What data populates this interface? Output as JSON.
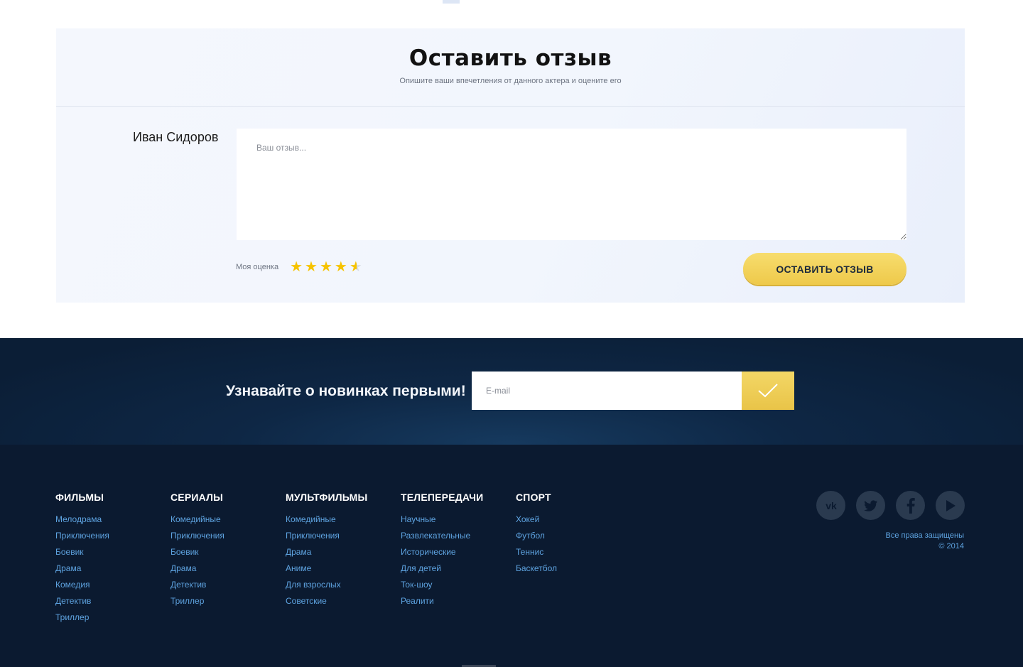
{
  "review": {
    "title": "Оставить отзыв",
    "subtitle": "Опишите ваши впечетления от данного актера и оцените его",
    "author": "Иван Сидоров",
    "textarea_placeholder": "Ваш отзыв...",
    "rating_label": "Моя оценка",
    "rating_value": 4.5,
    "rating_max": 5,
    "submit_label": "ОСТАВИТЬ ОТЗЫВ"
  },
  "subscribe": {
    "title": "Узнавайте о новинках первыми!",
    "email_placeholder": "E-mail",
    "submit_icon": "checkmark-icon"
  },
  "footer": {
    "columns": [
      {
        "title": "ФИЛЬМЫ",
        "links": [
          "Мелодрама",
          "Приключения",
          "Боевик",
          "Драма",
          "Комедия",
          "Детектив",
          "Триллер"
        ]
      },
      {
        "title": "СЕРИАЛЫ",
        "links": [
          "Комедийные",
          "Приключения",
          "Боевик",
          "Драма",
          "Детектив",
          "Триллер"
        ]
      },
      {
        "title": "МУЛЬТФИЛЬМЫ",
        "links": [
          "Комедийные",
          "Приключения",
          "Драма",
          "Аниме",
          "Для взрослых",
          "Советские"
        ]
      },
      {
        "title": "ТЕЛЕПЕРЕДАЧИ",
        "links": [
          "Научные",
          "Развлекательные",
          "Исторические",
          "Для детей",
          "Ток-шоу",
          "Реалити"
        ]
      },
      {
        "title": "СПОРТ",
        "links": [
          "Хокей",
          "Футбол",
          "Теннис",
          "Баскетбол"
        ]
      }
    ],
    "social_icons": [
      "vk-icon",
      "twitter-icon",
      "facebook-icon",
      "youtube-play-icon"
    ],
    "rights": "Все права защищены",
    "year": "© 2014"
  },
  "colors": {
    "accent_gold": "#eec94a",
    "footer_bg": "#0b1a30",
    "link_blue": "#5ea3e0",
    "star": "#f6c300"
  }
}
